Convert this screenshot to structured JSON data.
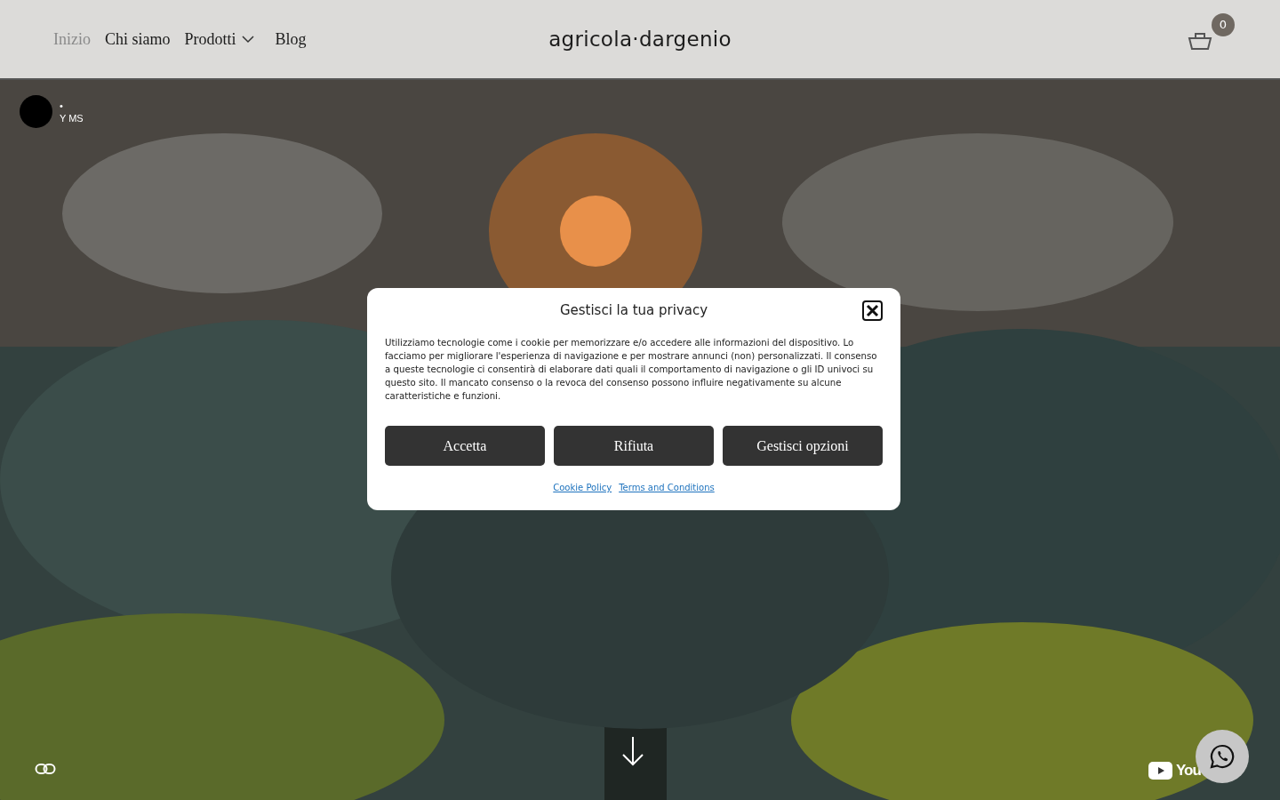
{
  "header": {
    "nav": [
      {
        "label": "Inizio",
        "selected": true,
        "dropdown": false
      },
      {
        "label": "Chi siamo",
        "selected": false,
        "dropdown": false
      },
      {
        "label": "Prodotti",
        "selected": false,
        "dropdown": true
      },
      {
        "label": "Blog",
        "selected": false,
        "dropdown": false
      }
    ],
    "logo": "agricola·dargenio",
    "cart_count": "0"
  },
  "video": {
    "channel_dot": "•",
    "channel_name": "Y MS",
    "logo_text": "You"
  },
  "privacy_dialog": {
    "title": "Gestisci la tua privacy",
    "body": "Utilizziamo tecnologie come i cookie per memorizzare e/o accedere alle informazioni del dispositivo. Lo facciamo per migliorare l'esperienza di navigazione e per mostrare annunci (non) personalizzati. Il consenso a queste tecnologie ci consentirà di elaborare dati quali il comportamento di navigazione o gli ID univoci su questo sito. Il mancato consenso o la revoca del consenso possono influire negativamente su alcune caratteristiche e funzioni.",
    "buttons": [
      "Accetta",
      "Rifiuta",
      "Gestisci opzioni"
    ],
    "links": [
      "Cookie Policy",
      "Terms and Conditions"
    ]
  }
}
